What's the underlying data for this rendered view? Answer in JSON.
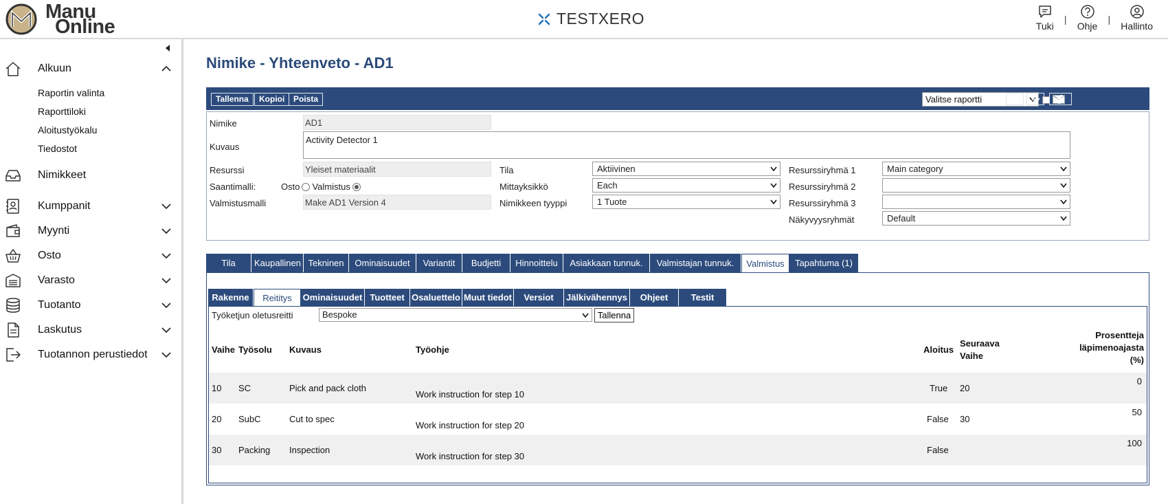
{
  "brand": {
    "logo_line1": "Manu",
    "logo_line2": "Online",
    "company": "TESTXERO",
    "accent": "#2c4b7c"
  },
  "topnav": [
    {
      "label": "Tuki",
      "icon": "chat-icon"
    },
    {
      "label": "Ohje",
      "icon": "help-icon"
    },
    {
      "label": "Hallinto",
      "icon": "user-icon"
    }
  ],
  "topnav_sep": "|",
  "sidebar": {
    "items": [
      {
        "label": "Alkuun",
        "icon": "home-icon",
        "expanded": true
      },
      {
        "label": "Nimikkeet",
        "icon": "inbox-icon"
      },
      {
        "label": "Kumppanit",
        "icon": "contacts-icon"
      },
      {
        "label": "Myynti",
        "icon": "wallet-icon"
      },
      {
        "label": "Osto",
        "icon": "basket-icon"
      },
      {
        "label": "Varasto",
        "icon": "warehouse-icon"
      },
      {
        "label": "Tuotanto",
        "icon": "database-icon"
      },
      {
        "label": "Laskutus",
        "icon": "document-icon"
      },
      {
        "label": "Tuotannon perustiedot",
        "icon": "exit-icon"
      }
    ],
    "subitems": [
      "Raportin valinta",
      "Raporttiloki",
      "Aloitustyökalu",
      "Tiedostot"
    ]
  },
  "page": {
    "title": "Nimike - Yhteenveto - AD1"
  },
  "toolbar": {
    "save": "Tallenna",
    "copy": "Kopioi",
    "delete": "Poista",
    "report_select": "Valitse raportti",
    "prev": "<<",
    "next": ">>"
  },
  "form": {
    "nimike_label": "Nimike",
    "nimike_value": "AD1",
    "kuvaus_label": "Kuvaus",
    "kuvaus_value": "Activity Detector 1",
    "resurssi_label": "Resurssi",
    "resurssi_value": "Yleiset materiaalit",
    "saantimalli_label": "Saantimalli:",
    "osto_label": "Osto",
    "valmistus_label": "Valmistus",
    "valmistusmalli_label": "Valmistusmalli",
    "valmistusmalli_value": "Make AD1 Version 4",
    "tila_label": "Tila",
    "tila_value": "Aktiivinen",
    "mittayksikko_label": "Mittayksikkö",
    "mittayksikko_value": "Each",
    "tyyppi_label": "Nimikkeen tyyppi",
    "tyyppi_value": "1 Tuote",
    "rr1_label": "Resurssiryhmä 1",
    "rr1_value": "Main category",
    "rr2_label": "Resurssiryhmä 2",
    "rr2_value": "",
    "rr3_label": "Resurssiryhmä 3",
    "rr3_value": "",
    "nakyvyys_label": "Näkyvyysryhmät",
    "nakyvyys_value": "Default"
  },
  "tabs": [
    "Tila",
    "Kaupallinen",
    "Tekninen",
    "Ominaisuudet",
    "Variantit",
    "Budjetti",
    "Hinnoittelu",
    "Asiakkaan tunnuk.",
    "Valmistajan tunnuk.",
    "Valmistus",
    "Tapahtuma (1)"
  ],
  "subtabs": [
    "Rakenne",
    "Reititys",
    "Ominaisuudet",
    "Tuotteet",
    "Osaluettelo",
    "Muut tiedot",
    "Versiot",
    "Jälkivähennys",
    "Ohjeet",
    "Testit"
  ],
  "routing": {
    "default_label": "Työketjun oletusreitti",
    "default_value": "Bespoke",
    "save": "Tallenna",
    "headers": {
      "step": "Vaihe",
      "cell": "Työsolu",
      "desc": "Kuvaus",
      "instr": "Työohje",
      "start": "Aloitus",
      "next_line1": "Seuraava",
      "next_line2": "Vaihe",
      "pct_line1": "Prosentteja",
      "pct_line2": "läpimenoajasta",
      "pct_line3": "(%)"
    },
    "rows": [
      {
        "step": "10",
        "cell": "SC",
        "desc": "Pick and pack cloth",
        "instr": "Work instruction for step 10",
        "start": "True",
        "next": "20",
        "pct": "0"
      },
      {
        "step": "20",
        "cell": "SubC",
        "desc": "Cut to spec",
        "instr": "Work instruction for step 20",
        "start": "False",
        "next": "30",
        "pct": "50"
      },
      {
        "step": "30",
        "cell": "Packing",
        "desc": "Inspection",
        "instr": "Work instruction for step 30",
        "start": "False",
        "next": "",
        "pct": "100"
      }
    ]
  }
}
